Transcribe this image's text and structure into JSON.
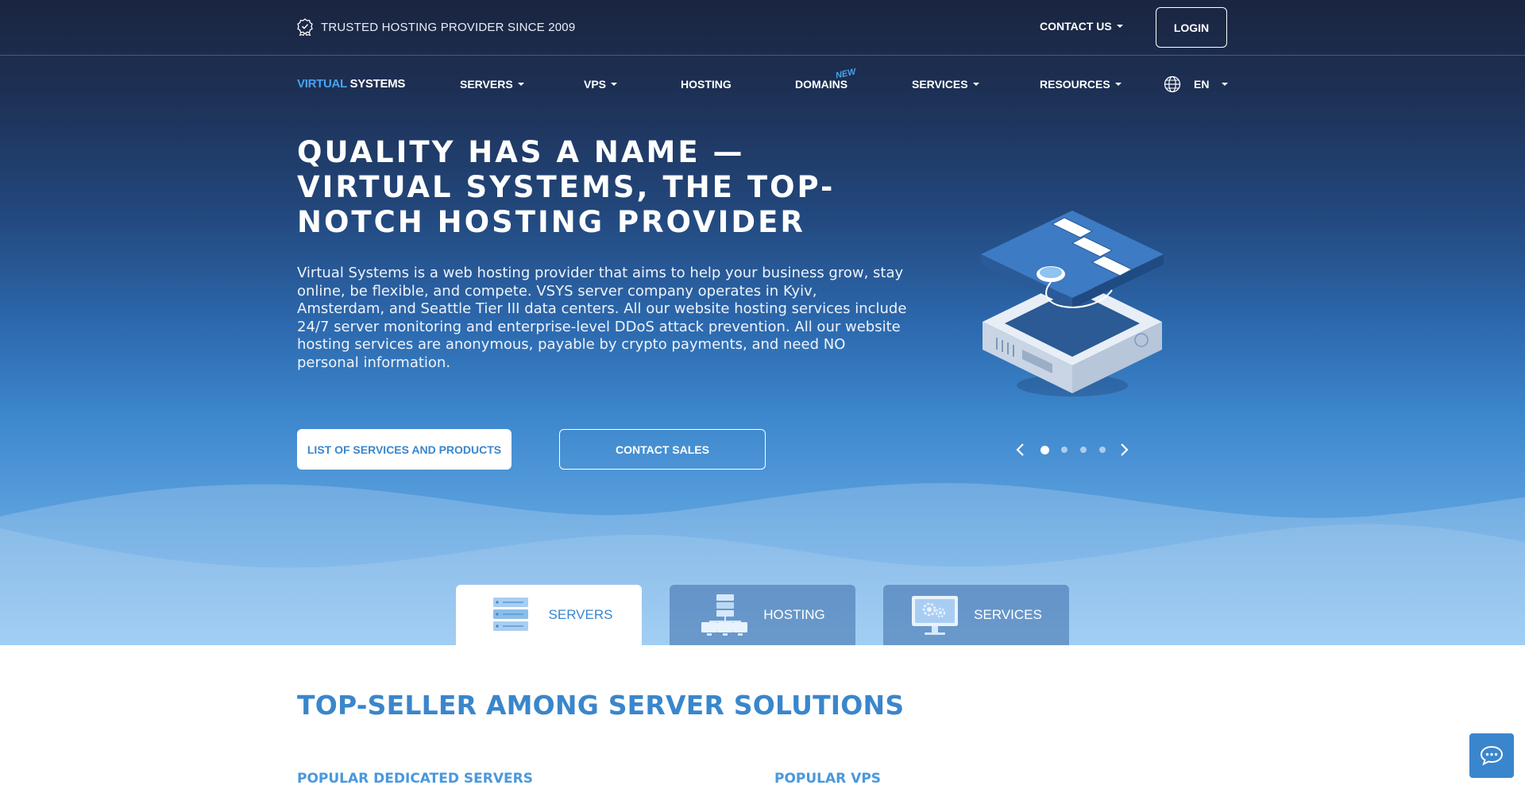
{
  "topbar": {
    "trusted_text": "TRUSTED HOSTING PROVIDER SINCE 2009",
    "contact_us": "CONTACT US",
    "login": "LOGIN"
  },
  "nav": {
    "logo_part1": "VIRTUAL",
    "logo_part2": " SYSTEMS",
    "items": [
      {
        "label": "SERVERS",
        "has_dropdown": true
      },
      {
        "label": "VPS",
        "has_dropdown": true
      },
      {
        "label": "HOSTING",
        "has_dropdown": false
      },
      {
        "label": "DOMAINS",
        "has_dropdown": false
      },
      {
        "label": "SERVICES",
        "has_dropdown": true
      },
      {
        "label": "RESOURCES",
        "has_dropdown": true
      }
    ],
    "domains_badge": "NEW",
    "language": "EN"
  },
  "hero": {
    "title": "QUALITY HAS A NAME — VIRTUAL SYSTEMS, THE TOP-NOTCH HOSTING PROVIDER",
    "description": "Virtual Systems is a web hosting provider that aims to help your business grow, stay online, be flexible, and compete. VSYS server company operates in Kyiv, Amsterdam, and Seattle Tier III data centers. All our website hosting services include 24/7 server monitoring and enterprise-level DDoS attack prevention. All our website hosting services are anonymous, payable by crypto payments, and need NO personal information.",
    "primary_button": "LIST OF SERVICES AND PRODUCTS",
    "secondary_button": "CONTACT SALES",
    "slider": {
      "total": 4,
      "active": 1
    }
  },
  "tabs": [
    {
      "label": "SERVERS",
      "icon": "server-rack-icon",
      "active": true
    },
    {
      "label": "HOSTING",
      "icon": "hosting-network-icon",
      "active": false
    },
    {
      "label": "SERVICES",
      "icon": "services-monitor-icon",
      "active": false
    }
  ],
  "main": {
    "section_title": "TOP-SELLER AMONG SERVER SOLUTIONS",
    "sub_left": "POPULAR DEDICATED SERVERS",
    "sub_right": "POPULAR VPS"
  },
  "colors": {
    "accent": "#3a86cc",
    "light_accent": "#4aa3f0",
    "topbar_bg": "#1a2540"
  }
}
